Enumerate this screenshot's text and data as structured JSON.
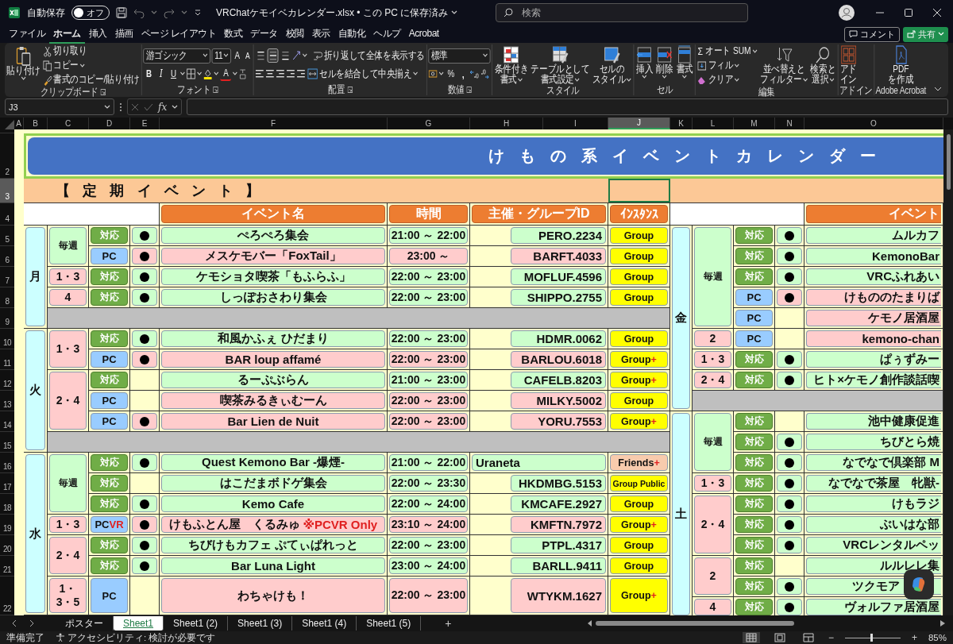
{
  "titlebar": {
    "autosave_label": "自動保存",
    "autosave": {
      "label": "オフ",
      "on": false
    },
    "file": "VRChatケモイベカレンダー.xlsx • この PC に保存済み",
    "search": {
      "placeholder": "検索"
    }
  },
  "menu_tabs": [
    {
      "label": "ファイル",
      "selected": false
    },
    {
      "label": "ホーム",
      "selected": true
    },
    {
      "label": "挿入",
      "selected": false
    },
    {
      "label": "描画",
      "selected": false
    },
    {
      "label": "ページ レイアウト",
      "selected": false
    },
    {
      "label": "数式",
      "selected": false
    },
    {
      "label": "データ",
      "selected": false
    },
    {
      "label": "校閲",
      "selected": false
    },
    {
      "label": "表示",
      "selected": false
    },
    {
      "label": "自動化",
      "selected": false
    },
    {
      "label": "ヘルプ",
      "selected": false
    },
    {
      "label": "Acrobat",
      "selected": false
    }
  ],
  "actions": {
    "comment": "コメント",
    "share": "共有"
  },
  "ribbon": {
    "clipboard": {
      "paste": "貼り付け",
      "cut": "切り取り",
      "copy": "コピー",
      "painter": "書式のコピー/貼り付け",
      "label": "クリップボード"
    },
    "font": {
      "family": "游ゴシック",
      "size": "11",
      "grow_button": "A",
      "shrink_button": "A",
      "bold": "B",
      "italic": "I",
      "underline": "U",
      "color_button": "A",
      "label": "フォント"
    },
    "alignment": {
      "vertical": [
        {
          "selected": false
        },
        {
          "selected": true
        },
        {
          "selected": false
        }
      ],
      "wrap": "折り返して全体を表示する",
      "merge": "セルを結合して中央揃え",
      "label": "配置"
    },
    "number": {
      "format": "標準",
      "percent": "%",
      "comma": ",",
      "label": "数値"
    },
    "styles": {
      "buttons": [
        {
          "kind": "conditional",
          "lines": [
            "条件付き",
            "書式"
          ]
        },
        {
          "kind": "table",
          "lines": [
            "テーブルとして",
            "書式設定"
          ]
        },
        {
          "kind": "cell",
          "lines": [
            "セルの",
            "スタイル"
          ]
        }
      ],
      "label": "スタイル"
    },
    "cells": {
      "buttons": [
        {
          "kind": "insert",
          "lines": [
            "挿入"
          ]
        },
        {
          "kind": "delete",
          "lines": [
            "削除"
          ]
        },
        {
          "kind": "format",
          "lines": [
            "書式"
          ]
        }
      ],
      "label": "セル"
    },
    "editing": {
      "sum_symbol": "Σ",
      "autosum": "オート SUM",
      "fill": "フィル",
      "clear": "クリア",
      "buttons": [
        {
          "kind": "sort",
          "lines": [
            "並べ替えと",
            "フィルター"
          ]
        },
        {
          "kind": "find",
          "lines": [
            "検索と",
            "選択"
          ]
        }
      ],
      "label": "編集"
    },
    "addins": {
      "lines": [
        "アド",
        "イン"
      ],
      "label": "アドイン"
    },
    "acrobat": {
      "lines": [
        "PDF",
        "を作成"
      ],
      "label": "Adobe Acrobat"
    }
  },
  "formula_bar": {
    "name_box": "J3",
    "fx": "fx"
  },
  "columns": [
    {
      "label": "A",
      "selected": false
    },
    {
      "label": "B",
      "selected": false
    },
    {
      "label": "C",
      "selected": false
    },
    {
      "label": "D",
      "selected": false
    },
    {
      "label": "E",
      "selected": false
    },
    {
      "label": "F",
      "selected": false
    },
    {
      "label": "G",
      "selected": false
    },
    {
      "label": "H",
      "selected": false
    },
    {
      "label": "I",
      "selected": false
    },
    {
      "label": "J",
      "selected": true
    },
    {
      "label": "K",
      "selected": false
    },
    {
      "label": "L",
      "selected": false
    },
    {
      "label": "M",
      "selected": false
    },
    {
      "label": "N",
      "selected": false
    },
    {
      "label": "O",
      "selected": false
    }
  ],
  "rows": [
    {
      "label": "2",
      "selected": false
    },
    {
      "label": "3",
      "selected": true
    },
    {
      "label": "4",
      "selected": false
    },
    {
      "label": "5",
      "selected": false
    },
    {
      "label": "6",
      "selected": false
    },
    {
      "label": "7",
      "selected": false
    },
    {
      "label": "8",
      "selected": false
    },
    {
      "label": "9",
      "selected": false
    },
    {
      "label": "10",
      "selected": false
    },
    {
      "label": "11",
      "selected": false
    },
    {
      "label": "12",
      "selected": false
    },
    {
      "label": "13",
      "selected": false
    },
    {
      "label": "14",
      "selected": false
    },
    {
      "label": "15",
      "selected": false
    },
    {
      "label": "16",
      "selected": false
    },
    {
      "label": "17",
      "selected": false
    },
    {
      "label": "18",
      "selected": false
    },
    {
      "label": "19",
      "selected": false
    },
    {
      "label": "20",
      "selected": false
    },
    {
      "label": "21",
      "selected": false
    },
    {
      "label": "22",
      "selected": false
    }
  ],
  "sheet": {
    "title": "けもの系イベントカレンダー",
    "section": "【定期イベント】",
    "left": {
      "headers": [
        "イベント名",
        "時間",
        "主催・グループID",
        "ｲﾝｽﾀﾝｽ"
      ],
      "days": [
        {
          "day": "月",
          "groups": [
            {
              "freq": {
                "label": "毎週",
                "kind": "weekly"
              },
              "events": [
                {
                  "support": {
                    "label": "対応",
                    "kind": "all"
                  },
                  "dot": true,
                  "name": "ぺろぺろ集会",
                  "time": "21:00 ～ 22:00",
                  "host": {
                    "text": "PERO.2234",
                    "kind": "id"
                  },
                  "instance": {
                    "label": "Group",
                    "kind": "group"
                  }
                },
                {
                  "support": {
                    "label": "PC",
                    "kind": "pc"
                  },
                  "dot": true,
                  "name": "メスケモバー「FoxTail」",
                  "time": "23:00 ～",
                  "host": {
                    "text": "BARFT.4033",
                    "kind": "id"
                  },
                  "instance": {
                    "label": "Group",
                    "kind": "group"
                  }
                }
              ]
            },
            {
              "freq": {
                "label": "1・3",
                "kind": "monthly"
              },
              "events": [
                {
                  "support": {
                    "label": "対応",
                    "kind": "all"
                  },
                  "dot": true,
                  "name": "ケモショタ喫茶「もふらふ」",
                  "time": "22:00 ～ 23:00",
                  "host": {
                    "text": "MOFLUF.4596",
                    "kind": "id"
                  },
                  "instance": {
                    "label": "Group",
                    "kind": "group"
                  }
                }
              ]
            },
            {
              "freq": {
                "label": "4",
                "kind": "monthly"
              },
              "events": [
                {
                  "support": {
                    "label": "対応",
                    "kind": "all"
                  },
                  "dot": true,
                  "name": "しっぽおさわり集会",
                  "time": "22:00 ～ 23:00",
                  "host": {
                    "text": "SHIPPO.2755",
                    "kind": "id"
                  },
                  "instance": {
                    "label": "Group",
                    "kind": "group"
                  }
                }
              ]
            }
          ]
        },
        {
          "day": "火",
          "groups": [
            {
              "freq": {
                "label": "1・3",
                "kind": "monthly"
              },
              "events": [
                {
                  "support": {
                    "label": "対応",
                    "kind": "all"
                  },
                  "dot": true,
                  "name": "和風かふぇ ひだまり",
                  "time": "22:00 ～ 23:00",
                  "host": {
                    "text": "HDMR.0062",
                    "kind": "id"
                  },
                  "instance": {
                    "label": "Group",
                    "kind": "group"
                  }
                },
                {
                  "support": {
                    "label": "PC",
                    "kind": "pc"
                  },
                  "dot": true,
                  "name": "BAR loup affamé",
                  "time": "22:00 ～ 23:00",
                  "host": {
                    "text": "BARLOU.6018",
                    "kind": "id"
                  },
                  "instance": {
                    "label": "Group",
                    "extra": "+",
                    "kind": "group"
                  }
                }
              ]
            },
            {
              "freq": {
                "label": "2・4",
                "kind": "monthly"
              },
              "events": [
                {
                  "support": {
                    "label": "対応",
                    "kind": "all"
                  },
                  "dot": false,
                  "name": "るーぷぶらん",
                  "time": "21:00 ～ 23:00",
                  "host": {
                    "text": "CAFELB.8203",
                    "kind": "id"
                  },
                  "instance": {
                    "label": "Group",
                    "extra": "+",
                    "kind": "group"
                  }
                },
                {
                  "support": {
                    "label": "PC",
                    "kind": "pc"
                  },
                  "dot": false,
                  "name": "喫茶みるきぃむーん",
                  "time": "22:00 ～ 23:00",
                  "host": {
                    "text": "MILKY.5002",
                    "kind": "id"
                  },
                  "instance": {
                    "label": "Group",
                    "kind": "group"
                  }
                },
                {
                  "support": {
                    "label": "PC",
                    "kind": "pc"
                  },
                  "dot": true,
                  "name": "Bar Lien de Nuit",
                  "time": "22:00 ～ 23:00",
                  "host": {
                    "text": "YORU.7553",
                    "kind": "id"
                  },
                  "instance": {
                    "label": "Group",
                    "extra": "+",
                    "kind": "group"
                  }
                }
              ]
            }
          ]
        },
        {
          "day": "水",
          "groups": [
            {
              "freq": {
                "label": "毎週",
                "kind": "weekly"
              },
              "events": [
                {
                  "support": {
                    "label": "対応",
                    "kind": "all"
                  },
                  "dot": true,
                  "name": "Quest Kemono Bar -爆煙-",
                  "time": "21:00 ～ 22:00",
                  "host": {
                    "text": "Uraneta",
                    "kind": "name"
                  },
                  "instance": {
                    "label": "Friends",
                    "extra": "+",
                    "kind": "friends"
                  }
                },
                {
                  "support": {
                    "label": "対応",
                    "kind": "all"
                  },
                  "dot": false,
                  "name": "はこだまボドゲ集会",
                  "time": "22:00 ～ 23:30",
                  "host": {
                    "text": "HKDMBG.5153",
                    "kind": "id"
                  },
                  "instance": {
                    "label": "Group Public",
                    "kind": "group_public"
                  }
                },
                {
                  "support": {
                    "label": "対応",
                    "kind": "all"
                  },
                  "dot": true,
                  "name": "Kemo Cafe",
                  "time": "22:00 ～ 24:00",
                  "host": {
                    "text": "KMCAFE.2927",
                    "kind": "id"
                  },
                  "instance": {
                    "label": "Group",
                    "kind": "group"
                  }
                }
              ]
            },
            {
              "freq": {
                "label": "1・3",
                "kind": "monthly"
              },
              "events": [
                {
                  "support": {
                    "label": "PC",
                    "suffix": "VR",
                    "kind": "pc"
                  },
                  "dot": true,
                  "name": "けもふとん屋　くるみゅ",
                  "note": "※PCVR Only",
                  "time": "23:10 ～ 24:00",
                  "host": {
                    "text": "KMFTN.7972",
                    "kind": "id"
                  },
                  "instance": {
                    "label": "Group",
                    "extra": "+",
                    "kind": "group"
                  }
                }
              ]
            },
            {
              "freq": {
                "label": "2・4",
                "kind": "monthly"
              },
              "events": [
                {
                  "support": {
                    "label": "対応",
                    "kind": "all"
                  },
                  "dot": true,
                  "name": "ちびけもカフェ ぷてぃぱれっと",
                  "time": "22:00 ～ 23:00",
                  "host": {
                    "text": "PTPL.4317",
                    "kind": "id"
                  },
                  "instance": {
                    "label": "Group",
                    "kind": "group"
                  }
                },
                {
                  "support": {
                    "label": "対応",
                    "kind": "all"
                  },
                  "dot": true,
                  "name": "Bar Luna Light",
                  "time": "23:00 ～ 24:00",
                  "host": {
                    "text": "BARLL.9411",
                    "kind": "id"
                  },
                  "instance": {
                    "label": "Group",
                    "kind": "group"
                  }
                }
              ]
            },
            {
              "freq": {
                "label": "1・3・5",
                "kind": "monthly"
              },
              "events": [
                {
                  "support": {
                    "label": "PC",
                    "kind": "pc"
                  },
                  "dot": false,
                  "name": "わちゃけも！",
                  "time": "22:00 ～ 23:00",
                  "host": {
                    "text": "WTYKM.1627",
                    "kind": "id"
                  },
                  "instance": {
                    "label": "Group",
                    "extra": "+",
                    "kind": "group"
                  }
                }
              ]
            }
          ]
        }
      ]
    },
    "right": {
      "headers": [
        "イベント"
      ],
      "days": [
        {
          "day": "金",
          "groups": [
            {
              "freq": {
                "label": "毎週",
                "kind": "weekly"
              },
              "events": [
                {
                  "support": {
                    "label": "対応",
                    "kind": "all"
                  },
                  "dot": true,
                  "name": "ムルカフ"
                },
                {
                  "support": {
                    "label": "対応",
                    "kind": "all"
                  },
                  "dot": true,
                  "name": "KemonoBar"
                },
                {
                  "support": {
                    "label": "対応",
                    "kind": "all"
                  },
                  "dot": true,
                  "name": "VRCふれあい"
                },
                {
                  "support": {
                    "label": "PC",
                    "kind": "pc"
                  },
                  "dot": true,
                  "name": "けもののたまりば"
                },
                {
                  "support": {
                    "label": "PC",
                    "kind": "pc"
                  },
                  "dot": false,
                  "name": "ケモノ居酒屋"
                }
              ]
            },
            {
              "freq": {
                "label": "2",
                "kind": "monthly"
              },
              "events": [
                {
                  "support": {
                    "label": "PC",
                    "kind": "pc"
                  },
                  "dot": false,
                  "name": "kemono-chan"
                }
              ]
            },
            {
              "freq": {
                "label": "1・3",
                "kind": "monthly"
              },
              "events": [
                {
                  "support": {
                    "label": "対応",
                    "kind": "all"
                  },
                  "dot": true,
                  "name": "ぱぅずみー"
                }
              ]
            },
            {
              "freq": {
                "label": "2・4",
                "kind": "monthly"
              },
              "events": [
                {
                  "support": {
                    "label": "対応",
                    "kind": "all"
                  },
                  "dot": true,
                  "name": "ヒト×ケモノ創作談話喫"
                }
              ]
            }
          ]
        },
        {
          "day": "土",
          "groups": [
            {
              "freq": {
                "label": "毎週",
                "kind": "weekly"
              },
              "events": [
                {
                  "support": {
                    "label": "対応",
                    "kind": "all"
                  },
                  "dot": false,
                  "name": "池中健康促進"
                },
                {
                  "support": {
                    "label": "対応",
                    "kind": "all"
                  },
                  "dot": true,
                  "name": "ちびとら焼"
                },
                {
                  "support": {
                    "label": "対応",
                    "kind": "all"
                  },
                  "dot": true,
                  "name": "なでなで倶楽部 M"
                }
              ]
            },
            {
              "freq": {
                "label": "1・3",
                "kind": "monthly"
              },
              "events": [
                {
                  "support": {
                    "label": "対応",
                    "kind": "all"
                  },
                  "dot": true,
                  "name": "なでなで茶屋　牝獣-"
                }
              ]
            },
            {
              "freq": {
                "label": "2・4",
                "kind": "monthly"
              },
              "events": [
                {
                  "support": {
                    "label": "対応",
                    "kind": "all"
                  },
                  "dot": true,
                  "name": "けもラジ"
                },
                {
                  "support": {
                    "label": "対応",
                    "kind": "all"
                  },
                  "dot": true,
                  "name": "ぶいはな部"
                },
                {
                  "support": {
                    "label": "対応",
                    "kind": "all"
                  },
                  "dot": true,
                  "name": "VRCレンタルペッ"
                }
              ]
            },
            {
              "freq": {
                "label": "2",
                "kind": "monthly"
              },
              "events": [
                {
                  "support": {
                    "label": "対応",
                    "kind": "all"
                  },
                  "dot": false,
                  "name": "ルルレレ集"
                },
                {
                  "support": {
                    "label": "対応",
                    "kind": "all"
                  },
                  "dot": true,
                  "name": "ツクモア",
                  "overlaid": true
                }
              ]
            },
            {
              "freq": {
                "label": "4",
                "kind": "monthly"
              },
              "events": [
                {
                  "support": {
                    "label": "対応",
                    "kind": "all"
                  },
                  "dot": true,
                  "name": "ヴォルファ居酒屋"
                }
              ]
            }
          ]
        }
      ]
    }
  },
  "sheet_tabs": [
    {
      "label": "ポスター",
      "selected": false
    },
    {
      "label": "Sheet1",
      "selected": true
    },
    {
      "label": "Sheet1 (2)",
      "selected": false
    },
    {
      "label": "Sheet1 (3)",
      "selected": false
    },
    {
      "label": "Sheet1 (4)",
      "selected": false
    },
    {
      "label": "Sheet1 (5)",
      "selected": false
    }
  ],
  "add_sheet": "+",
  "status_bar": {
    "ready": "準備完了",
    "accessibility": "アクセシビリティ: 検討が必要です",
    "zoom_out": "−",
    "zoom_in": "+",
    "zoom": {
      "level": 0.47
    },
    "zoom_label": "85%"
  }
}
